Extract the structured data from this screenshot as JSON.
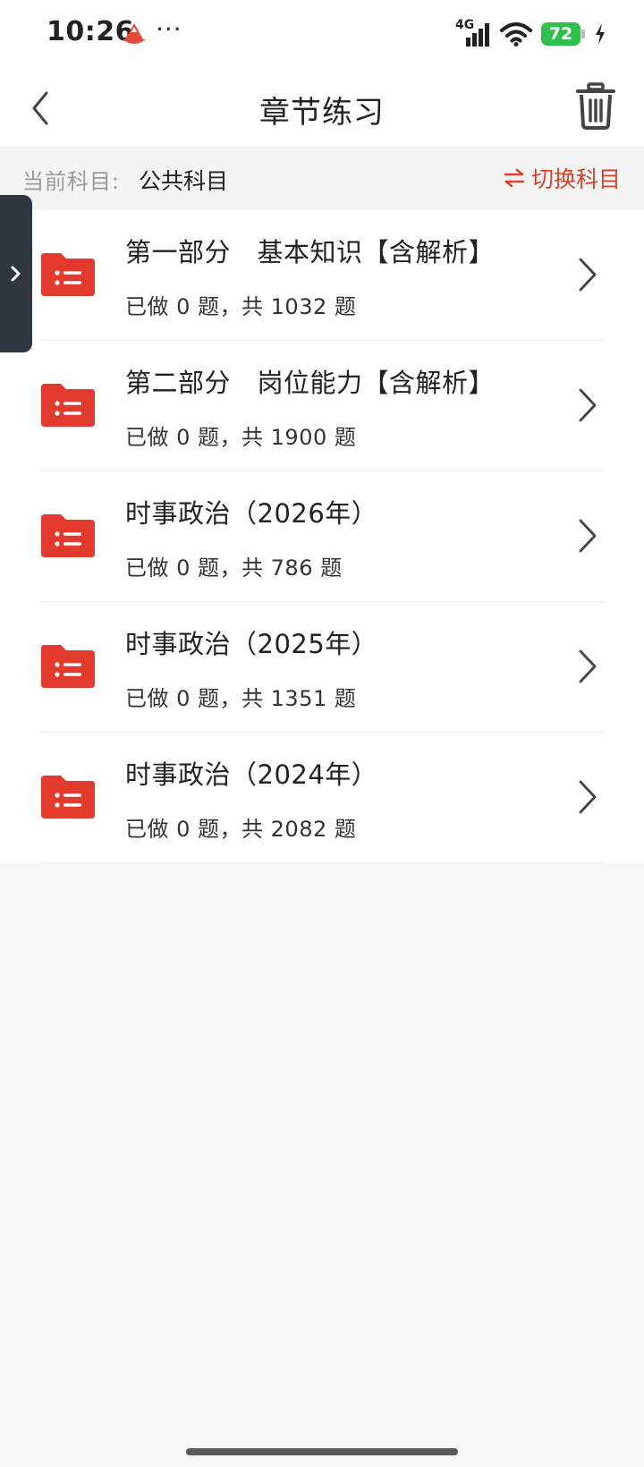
{
  "status_bar": {
    "time": "10:26",
    "dots": "···",
    "network": "4G",
    "battery": "72",
    "icons": [
      "app-notification-icon",
      "signal-icon",
      "wifi-icon",
      "battery-icon",
      "charging-icon"
    ]
  },
  "header": {
    "title": "章节练习",
    "icons": [
      "back-arrow-icon",
      "trash-icon"
    ]
  },
  "subject": {
    "label": "当前科目:",
    "value": "公共科目",
    "switch_label": "切换科目",
    "accent_color": "#d8432c"
  },
  "chapters": [
    {
      "title": "第一部分　基本知识【含解析】",
      "progress": "已做 0 题，共 1032 题"
    },
    {
      "title": "第二部分　岗位能力【含解析】",
      "progress": "已做 0 题，共 1900 题"
    },
    {
      "title": "时事政治（2026年）",
      "progress": "已做 0 题，共 786 题"
    },
    {
      "title": "时事政治（2025年）",
      "progress": "已做 0 题，共 1351 题"
    },
    {
      "title": "时事政治（2024年）",
      "progress": "已做 0 题，共 2082 题"
    }
  ],
  "colors": {
    "folder_icon": "#e23b2e",
    "side_tab": "#2f3640",
    "battery": "#2fbf4c"
  }
}
